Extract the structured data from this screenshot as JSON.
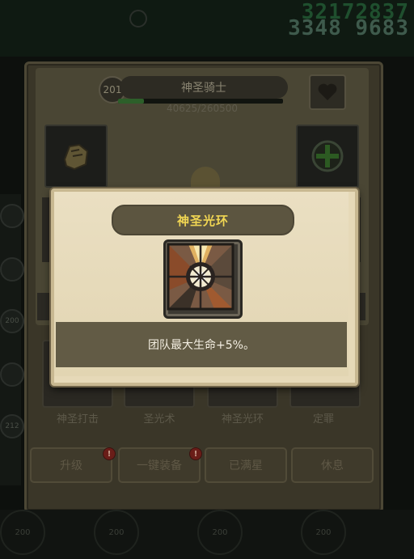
{
  "header": {
    "currency_primary": "32172837",
    "currency_secondary": "3348 9683"
  },
  "hero": {
    "level": "201",
    "name": "神圣骑士",
    "exp_text": "40625/260500",
    "exp_progress": 0.156
  },
  "skills": [
    {
      "label": "神圣打击"
    },
    {
      "label": "圣光术"
    },
    {
      "label": "神圣光环"
    },
    {
      "label": "定罪"
    }
  ],
  "actions": {
    "upgrade": "升级",
    "equip_all": "一键装备",
    "star_max": "已满星",
    "rest": "休息",
    "alert_mark": "!"
  },
  "side_levels": [
    "200",
    "212"
  ],
  "bottom_levels": [
    "200",
    "200",
    "200",
    "200"
  ],
  "popup": {
    "title": "神圣光环",
    "description": "团队最大生命+5%。",
    "icon": "holy-aura-icon"
  },
  "colors": {
    "popup_title": "#f1d653",
    "popup_bg": "#e6d9b8",
    "desc_band": "#625b45"
  }
}
